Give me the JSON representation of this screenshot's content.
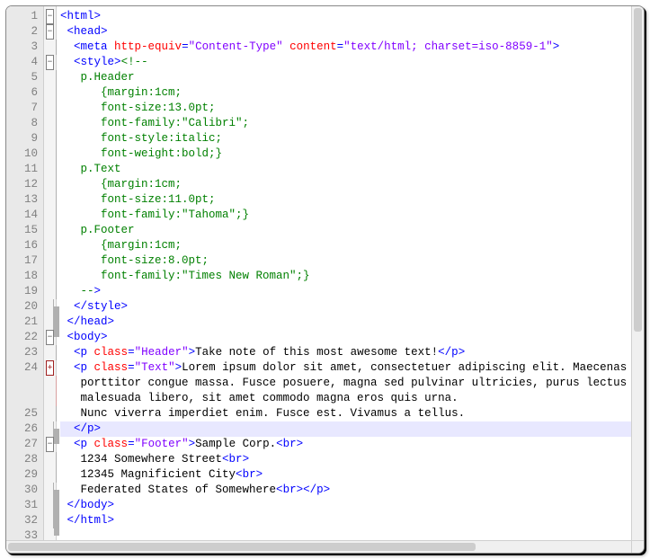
{
  "lines": [
    {
      "n": "1",
      "fold": "minus",
      "seg": [
        [
          "brkt",
          "<"
        ],
        [
          "tag",
          "html"
        ],
        [
          "brkt",
          ">"
        ]
      ]
    },
    {
      "n": "2",
      "fold": "minus",
      "seg": [
        [
          "txt",
          " "
        ],
        [
          "brkt",
          "<"
        ],
        [
          "tag",
          "head"
        ],
        [
          "brkt",
          ">"
        ]
      ]
    },
    {
      "n": "3",
      "fold": "line",
      "seg": [
        [
          "txt",
          "  "
        ],
        [
          "brkt",
          "<"
        ],
        [
          "tag",
          "meta "
        ],
        [
          "attr",
          "http-equiv"
        ],
        [
          "brkt",
          "="
        ],
        [
          "aval",
          "\"Content-Type\""
        ],
        [
          "tag",
          " "
        ],
        [
          "attr",
          "content"
        ],
        [
          "brkt",
          "="
        ],
        [
          "aval",
          "\"text/html; charset=iso-8859-1\""
        ],
        [
          "brkt",
          ">"
        ]
      ]
    },
    {
      "n": "4",
      "fold": "minus",
      "seg": [
        [
          "txt",
          "  "
        ],
        [
          "brkt",
          "<"
        ],
        [
          "tag",
          "style"
        ],
        [
          "brkt",
          ">"
        ],
        [
          "commc",
          "<!--"
        ]
      ]
    },
    {
      "n": "5",
      "fold": "line",
      "seg": [
        [
          "css",
          "   p.Header"
        ]
      ]
    },
    {
      "n": "6",
      "fold": "line",
      "seg": [
        [
          "css",
          "      {margin:1cm;"
        ]
      ]
    },
    {
      "n": "7",
      "fold": "line",
      "seg": [
        [
          "css",
          "      font-size:13.0pt;"
        ]
      ]
    },
    {
      "n": "8",
      "fold": "line",
      "seg": [
        [
          "css",
          "      font-family:\"Calibri\";"
        ]
      ]
    },
    {
      "n": "9",
      "fold": "line",
      "seg": [
        [
          "css",
          "      font-style:italic;"
        ]
      ]
    },
    {
      "n": "10",
      "fold": "line",
      "seg": [
        [
          "css",
          "      font-weight:bold;}"
        ]
      ]
    },
    {
      "n": "11",
      "fold": "line",
      "seg": [
        [
          "css",
          "   p.Text"
        ]
      ]
    },
    {
      "n": "12",
      "fold": "line",
      "seg": [
        [
          "css",
          "      {margin:1cm;"
        ]
      ]
    },
    {
      "n": "13",
      "fold": "line",
      "seg": [
        [
          "css",
          "      font-size:11.0pt;"
        ]
      ]
    },
    {
      "n": "14",
      "fold": "line",
      "seg": [
        [
          "css",
          "      font-family:\"Tahoma\";}"
        ]
      ]
    },
    {
      "n": "15",
      "fold": "line",
      "seg": [
        [
          "css",
          "   p.Footer"
        ]
      ]
    },
    {
      "n": "16",
      "fold": "line",
      "seg": [
        [
          "css",
          "      {margin:1cm;"
        ]
      ]
    },
    {
      "n": "17",
      "fold": "line",
      "seg": [
        [
          "css",
          "      font-size:8.0pt;"
        ]
      ]
    },
    {
      "n": "18",
      "fold": "line",
      "seg": [
        [
          "css",
          "      font-family:\"Times New Roman\";}"
        ]
      ]
    },
    {
      "n": "19",
      "fold": "line",
      "seg": [
        [
          "css",
          "   --"
        ],
        [
          "brkt",
          ">"
        ]
      ]
    },
    {
      "n": "20",
      "fold": "end",
      "seg": [
        [
          "txt",
          "  "
        ],
        [
          "brkt",
          "</"
        ],
        [
          "tag",
          "style"
        ],
        [
          "brkt",
          ">"
        ]
      ]
    },
    {
      "n": "21",
      "fold": "end",
      "seg": [
        [
          "txt",
          " "
        ],
        [
          "brkt",
          "</"
        ],
        [
          "tag",
          "head"
        ],
        [
          "brkt",
          ">"
        ]
      ]
    },
    {
      "n": "22",
      "fold": "minus",
      "seg": [
        [
          "txt",
          " "
        ],
        [
          "brkt",
          "<"
        ],
        [
          "tag",
          "body"
        ],
        [
          "brkt",
          ">"
        ]
      ]
    },
    {
      "n": "23",
      "fold": "line",
      "seg": [
        [
          "txt",
          "  "
        ],
        [
          "brkt",
          "<"
        ],
        [
          "tag",
          "p "
        ],
        [
          "attr",
          "class"
        ],
        [
          "brkt",
          "="
        ],
        [
          "aval",
          "\"Header\""
        ],
        [
          "brkt",
          ">"
        ],
        [
          "txt",
          "Take note of this most awesome text!"
        ],
        [
          "brkt",
          "</"
        ],
        [
          "tag",
          "p"
        ],
        [
          "brkt",
          ">"
        ]
      ]
    },
    {
      "n": "24",
      "fold": "plus",
      "seg": [
        [
          "txt",
          "  "
        ],
        [
          "brkt",
          "<"
        ],
        [
          "tag",
          "p "
        ],
        [
          "attr",
          "class"
        ],
        [
          "brkt",
          "="
        ],
        [
          "aval",
          "\"Text\""
        ],
        [
          "brkt",
          ">"
        ],
        [
          "txt",
          "Lorem ipsum dolor sit amet, consectetuer adipiscing elit. Maecenas"
        ]
      ]
    },
    {
      "n": "",
      "fold": "cont",
      "seg": [
        [
          "txt",
          "   porttitor congue massa. Fusce posuere, magna sed pulvinar ultricies, purus lectus"
        ]
      ]
    },
    {
      "n": "",
      "fold": "cont",
      "seg": [
        [
          "txt",
          "   malesuada libero, sit amet commodo magna eros quis urna."
        ]
      ]
    },
    {
      "n": "25",
      "fold": "line",
      "seg": [
        [
          "txt",
          "   Nunc viverra imperdiet enim. Fusce est. Vivamus a tellus."
        ]
      ]
    },
    {
      "n": "26",
      "fold": "end",
      "hl": true,
      "seg": [
        [
          "txt",
          "  "
        ],
        [
          "brkt",
          "</"
        ],
        [
          "tag",
          "p"
        ],
        [
          "brkt",
          ">"
        ]
      ]
    },
    {
      "n": "27",
      "fold": "minus",
      "seg": [
        [
          "txt",
          "  "
        ],
        [
          "brkt",
          "<"
        ],
        [
          "tag",
          "p "
        ],
        [
          "attr",
          "class"
        ],
        [
          "brkt",
          "="
        ],
        [
          "aval",
          "\"Footer\""
        ],
        [
          "brkt",
          ">"
        ],
        [
          "txt",
          "Sample Corp."
        ],
        [
          "brkt",
          "<"
        ],
        [
          "tag",
          "br"
        ],
        [
          "brkt",
          ">"
        ]
      ]
    },
    {
      "n": "28",
      "fold": "line",
      "seg": [
        [
          "txt",
          "   1234 Somewhere Street"
        ],
        [
          "brkt",
          "<"
        ],
        [
          "tag",
          "br"
        ],
        [
          "brkt",
          ">"
        ]
      ]
    },
    {
      "n": "29",
      "fold": "line",
      "seg": [
        [
          "txt",
          "   12345 Magnificient City"
        ],
        [
          "brkt",
          "<"
        ],
        [
          "tag",
          "br"
        ],
        [
          "brkt",
          ">"
        ]
      ]
    },
    {
      "n": "30",
      "fold": "end",
      "seg": [
        [
          "txt",
          "   Federated States of Somewhere"
        ],
        [
          "brkt",
          "<"
        ],
        [
          "tag",
          "br"
        ],
        [
          "brkt",
          "></"
        ],
        [
          "tag",
          "p"
        ],
        [
          "brkt",
          ">"
        ]
      ]
    },
    {
      "n": "31",
      "fold": "end",
      "seg": [
        [
          "txt",
          " "
        ],
        [
          "brkt",
          "</"
        ],
        [
          "tag",
          "body"
        ],
        [
          "brkt",
          ">"
        ]
      ]
    },
    {
      "n": "32",
      "fold": "end",
      "seg": [
        [
          "txt",
          " "
        ],
        [
          "brkt",
          "</"
        ],
        [
          "tag",
          "html"
        ],
        [
          "brkt",
          ">"
        ]
      ]
    },
    {
      "n": "33",
      "fold": "",
      "seg": []
    }
  ]
}
